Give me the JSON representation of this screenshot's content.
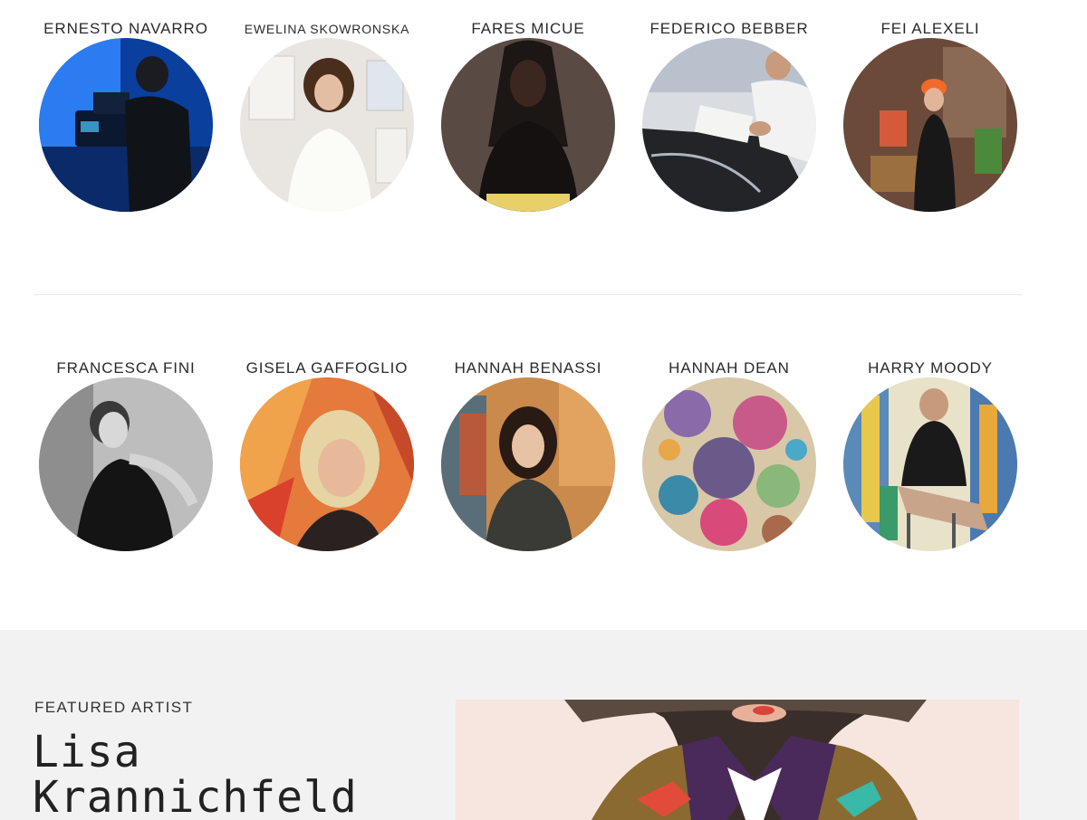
{
  "artists_row_1": [
    {
      "name": "ERNESTO NAVARRO",
      "photo": "person-with-camera-blue-lighting"
    },
    {
      "name": "EWELINA SKOWRONSKA",
      "photo": "woman-in-white-shirt-gallery"
    },
    {
      "name": "FARES MICUE",
      "photo": "woman-black-turtleneck"
    },
    {
      "name": "FEDERICO BEBBER",
      "photo": "man-signing-print"
    },
    {
      "name": "FEI ALEXELI",
      "photo": "woman-orange-beanie-studio"
    }
  ],
  "artists_row_2": [
    {
      "name": "FRANCESCA FINI",
      "photo": "black-and-white-portrait"
    },
    {
      "name": "GISELA GAFFOGLIO",
      "photo": "woman-colorful-painting-background"
    },
    {
      "name": "HANNAH BENASSI",
      "photo": "woman-in-front-of-artwork"
    },
    {
      "name": "HANNAH DEAN",
      "photo": "floral-abstract-painting"
    },
    {
      "name": "HARRY MOODY",
      "photo": "man-seated-before-abstract-canvas"
    }
  ],
  "featured": {
    "label": "FEATURED ARTIST",
    "name": "Lisa Krannichfeld",
    "image": "painted-portrait-curly-hair"
  },
  "colors": {
    "background": "#ffffff",
    "featured_background": "#f2f2f2",
    "text": "#2a2a2a"
  }
}
